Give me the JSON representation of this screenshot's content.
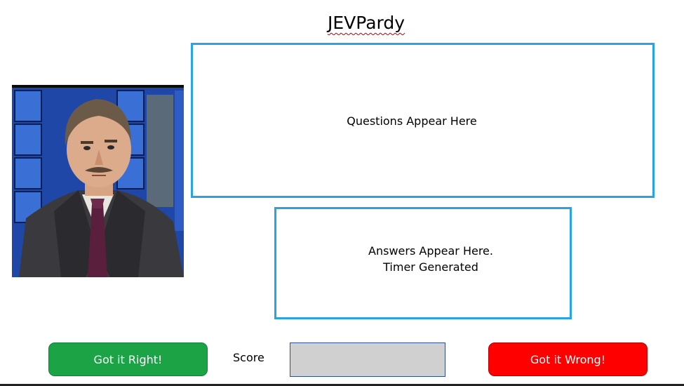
{
  "title": "JEVPardy",
  "portrait": {
    "icon": "host-portrait-photo"
  },
  "question_panel": {
    "text": "Questions Appear Here"
  },
  "answer_panel": {
    "line1": "Answers Appear Here.",
    "line2": "Timer Generated"
  },
  "controls": {
    "right_label": "Got it Right!",
    "score_label": "Score",
    "score_value": "",
    "wrong_label": "Got it Wrong!"
  },
  "colors": {
    "panel_border": "#29a3e3",
    "right_button": "#1ba346",
    "wrong_button": "#ff0000",
    "score_box": "#d0d0d0",
    "title_underline": "#c00000"
  }
}
